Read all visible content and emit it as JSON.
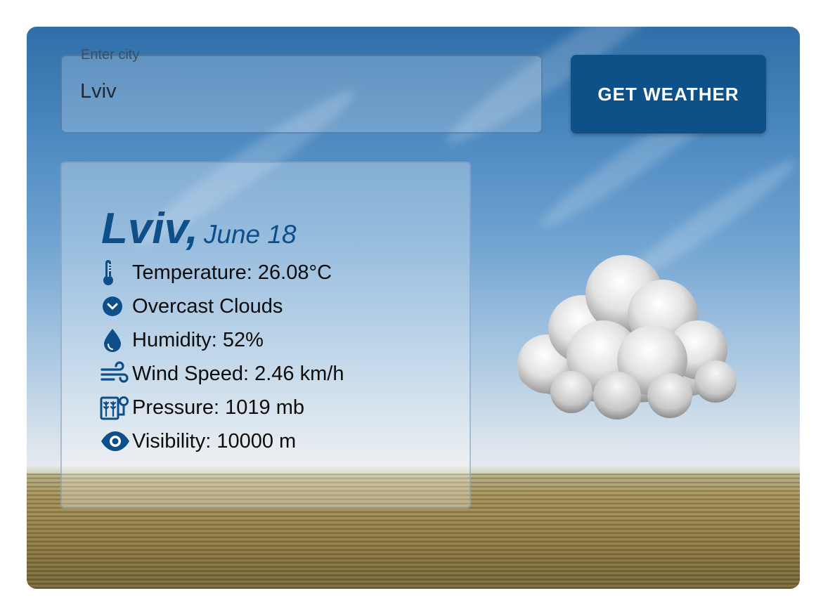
{
  "search": {
    "label": "Enter city",
    "value": "Lviv",
    "button_label": "GET WEATHER"
  },
  "weather": {
    "city": "Lviv,",
    "date": "June 18",
    "rows": [
      {
        "icon": "thermometer-icon",
        "text": "Temperature: 26.08°C"
      },
      {
        "icon": "chevron-circle-down-icon",
        "text": "Overcast Clouds"
      },
      {
        "icon": "droplet-icon",
        "text": "Humidity: 52%"
      },
      {
        "icon": "wind-icon",
        "text": "Wind Speed: 2.46 km/h"
      },
      {
        "icon": "pressure-icon",
        "text": "Pressure: 1019 mb"
      },
      {
        "icon": "eye-icon",
        "text": "Visibility: 10000 m"
      }
    ],
    "condition_image": "cloud-icon"
  },
  "colors": {
    "accent": "#0e5189",
    "heading": "#0e4f8a",
    "icon": "#0e4f8a"
  }
}
